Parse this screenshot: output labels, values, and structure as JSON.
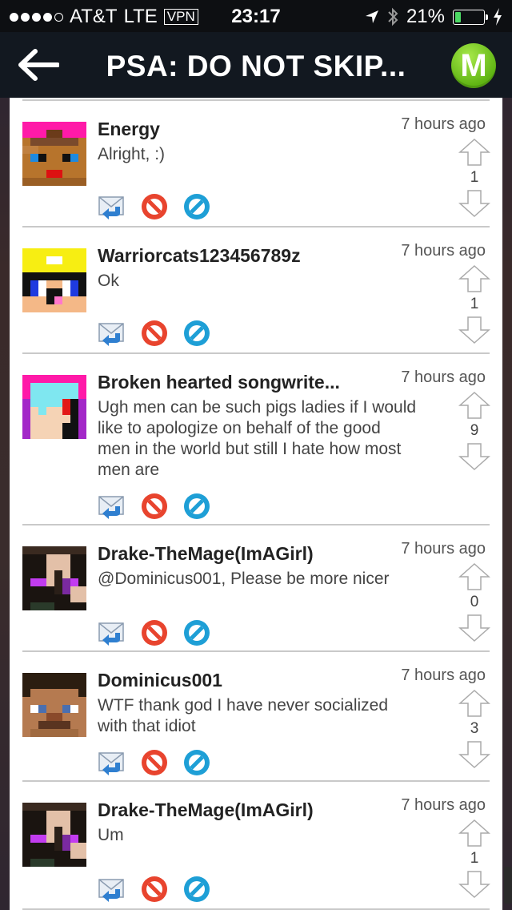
{
  "status_bar": {
    "carrier": "AT&T",
    "network": "LTE",
    "vpn": "VPN",
    "time": "23:17",
    "battery": "21%",
    "battery_level": 0.21
  },
  "header": {
    "title": "PSA: DO NOT SKIP...",
    "logo_letter": "M"
  },
  "comments": [
    {
      "username": "Energy",
      "text": "Alright, :)",
      "time": "7 hours ago",
      "votes": "1"
    },
    {
      "username": "Warriorcats123456789z",
      "text": "Ok",
      "time": "7 hours ago",
      "votes": "1"
    },
    {
      "username": "Broken hearted songwrite...",
      "text": "Ugh men can be such pigs ladies if I would like to apologize on behalf of the good men in the world but still I hate how most men are",
      "time": "7 hours ago",
      "votes": "9"
    },
    {
      "username": "Drake-TheMage(ImAGirl)",
      "text": "@Dominicus001, Please be more nicer",
      "time": "7 hours ago",
      "votes": "0"
    },
    {
      "username": "Dominicus001",
      "text": "WTF thank god I have never socialized with that idiot",
      "time": "7 hours ago",
      "votes": "3"
    },
    {
      "username": "Drake-TheMage(ImAGirl)",
      "text": "Um",
      "time": "7 hours ago",
      "votes": "1"
    }
  ],
  "colors": {
    "accent_green": "#5fb413",
    "block_red": "#e8442e",
    "block_blue": "#1e9fd6"
  },
  "icons": {
    "reply": "reply-icon",
    "report": "no-entry-red-icon",
    "block": "no-entry-blue-icon",
    "upvote": "arrow-up-icon",
    "downvote": "arrow-down-icon"
  }
}
